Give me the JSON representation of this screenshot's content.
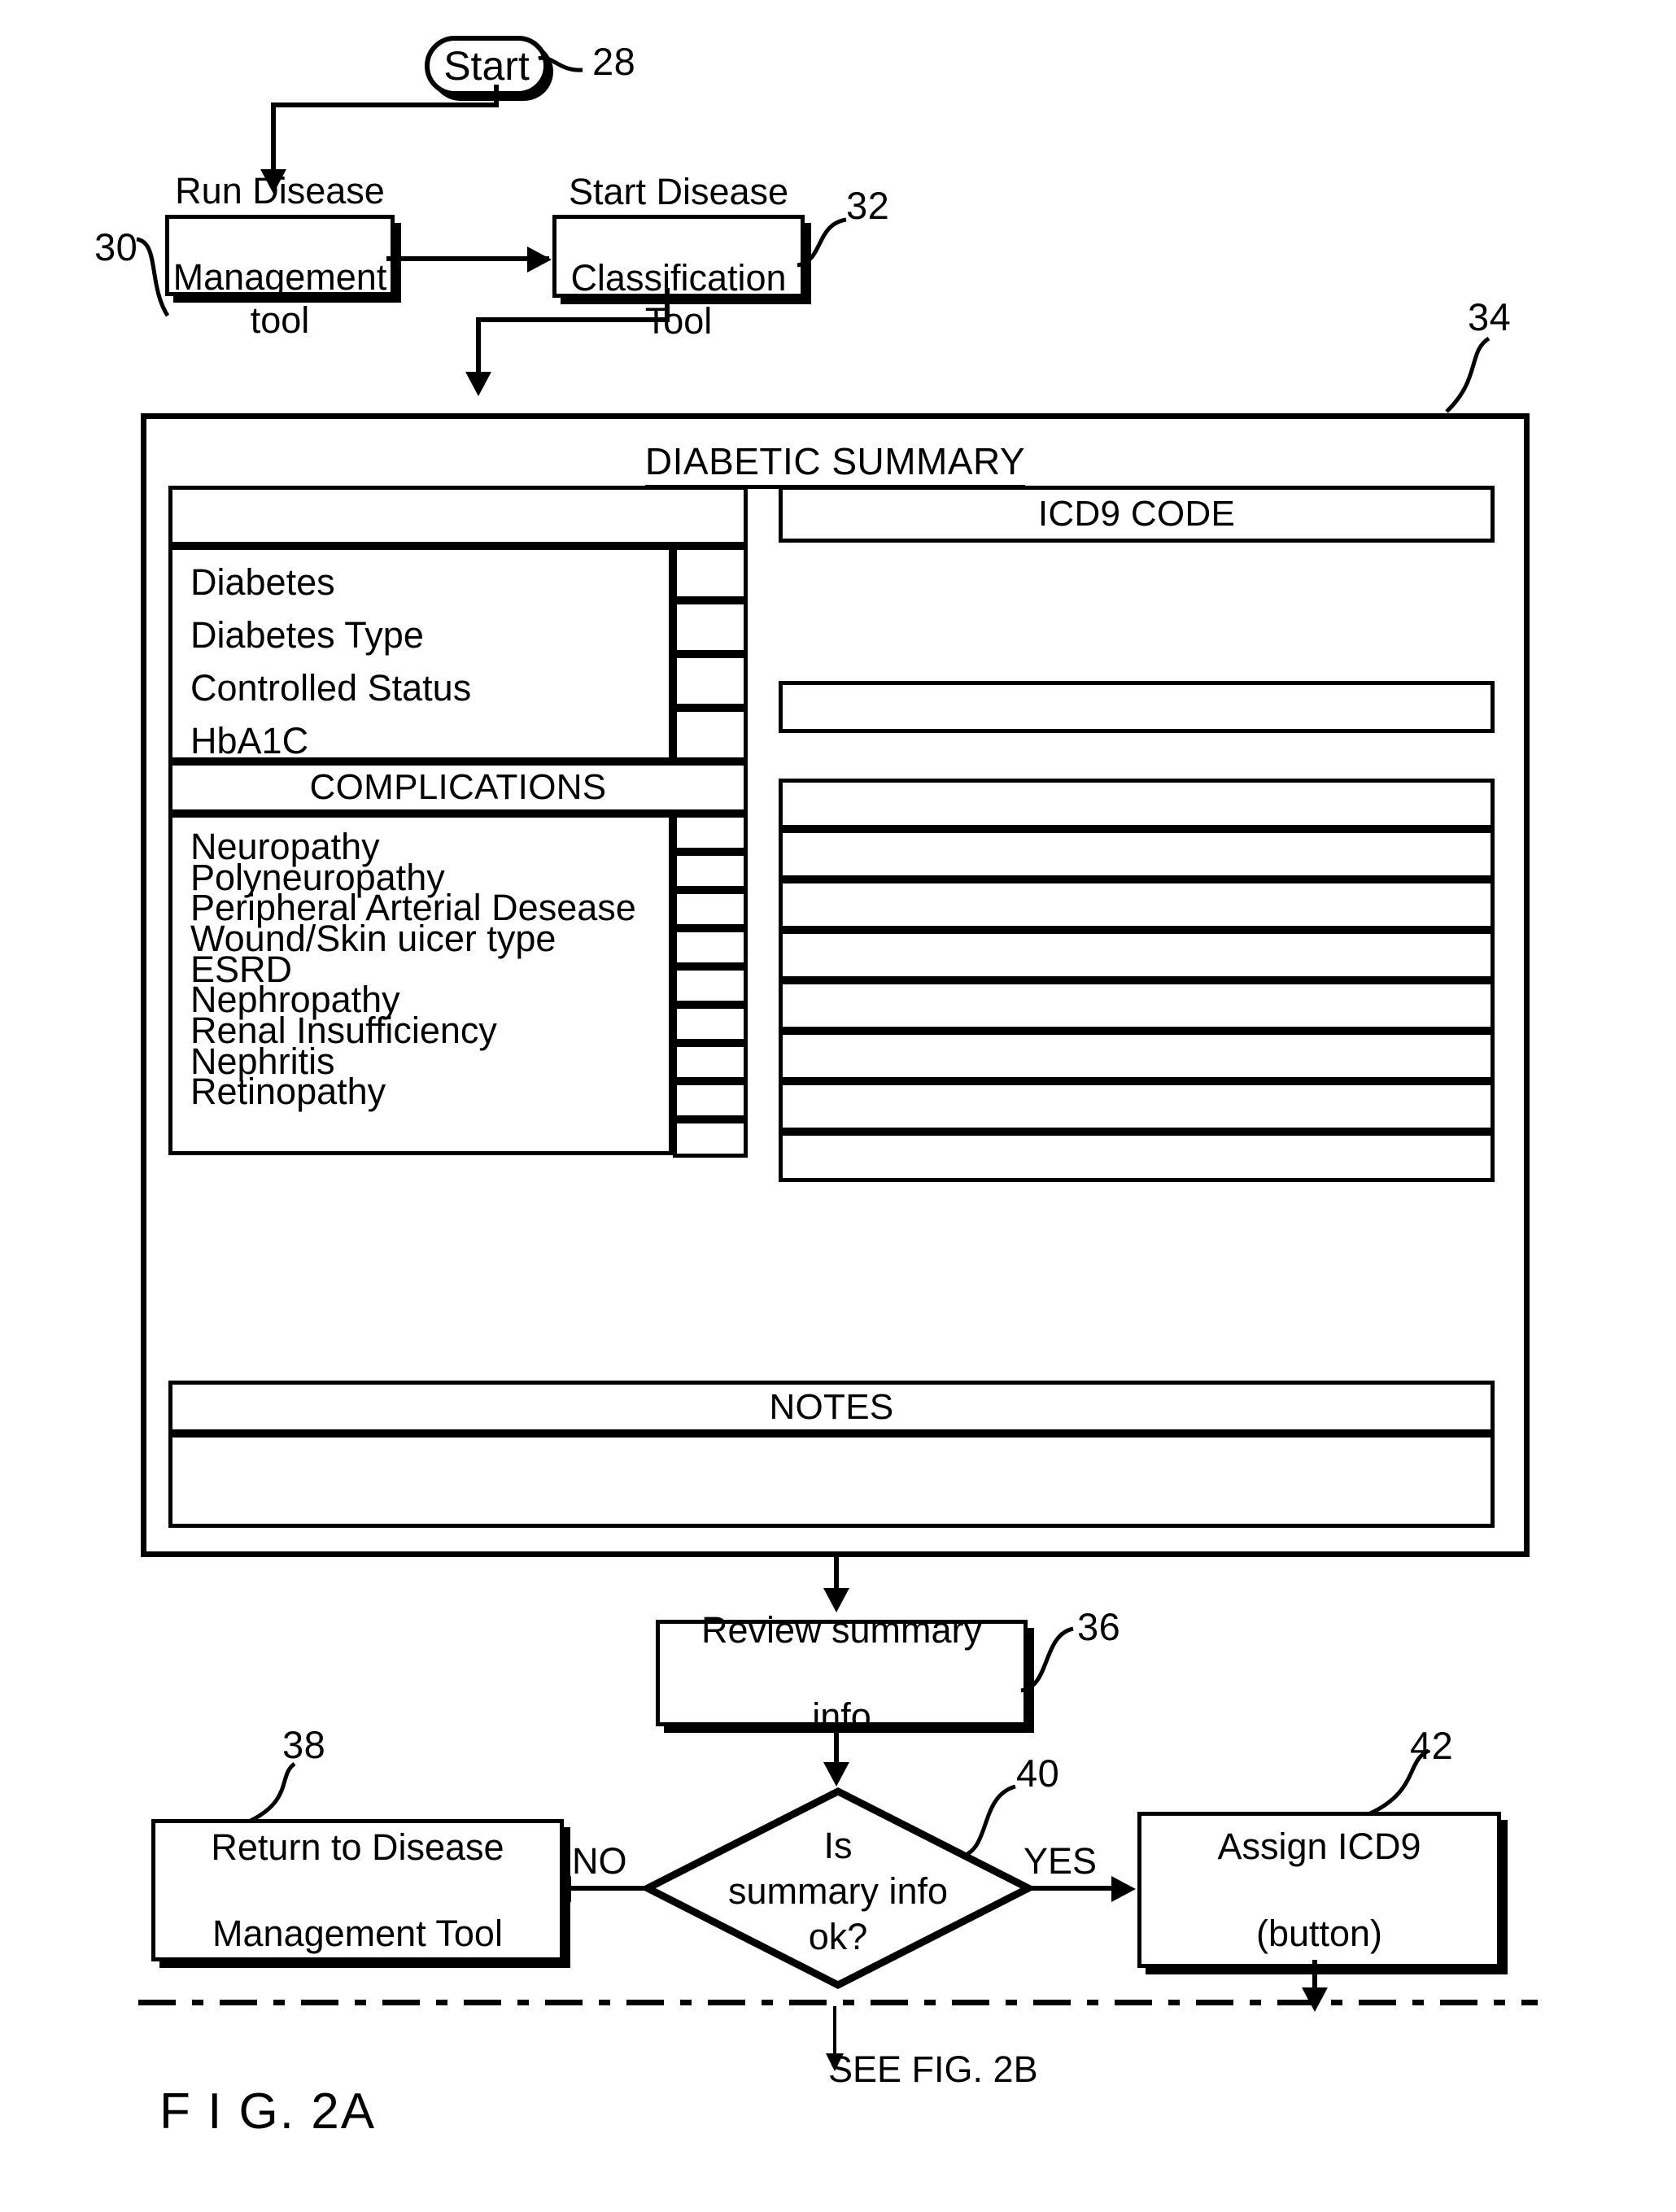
{
  "figure": {
    "label": "F I G. 2A",
    "see_next": "SEE FIG. 2B"
  },
  "flow": {
    "start": {
      "label": "Start",
      "ref": "28"
    },
    "run_dm_tool": {
      "label_line1": "Run Disease",
      "label_line2": "Management tool",
      "ref": "30"
    },
    "start_classification": {
      "label_line1": "Start Disease",
      "label_line2": "Classification Tool",
      "ref": "32"
    },
    "summary_panel_ref": "34",
    "review": {
      "label_line1": "Review summary",
      "label_line2": "info",
      "ref": "36"
    },
    "decision": {
      "label_line1": "Is",
      "label_line2": "summary info",
      "label_line3": "ok?",
      "ref": "40",
      "branch_no": "NO",
      "branch_yes": "YES"
    },
    "return_dm_tool": {
      "label_line1": "Return to Disease",
      "label_line2": "Management Tool",
      "ref": "38"
    },
    "assign_icd9": {
      "label_line1": "Assign ICD9",
      "label_line2": "(button)",
      "ref": "42"
    }
  },
  "summary_form": {
    "title": "DIABETIC SUMMARY",
    "left_panel": {
      "top_blank_header": "",
      "fields": [
        {
          "label": "Diabetes",
          "value": ""
        },
        {
          "label": "Diabetes Type",
          "value": ""
        },
        {
          "label": "Controlled Status",
          "value": ""
        },
        {
          "label": "HbA1C",
          "value": ""
        }
      ],
      "complications_header": "COMPLICATIONS",
      "complications": [
        {
          "label": "Neuropathy",
          "value": ""
        },
        {
          "label": "Polyneuropathy",
          "value": ""
        },
        {
          "label": "Peripheral Arterial Desease",
          "value": ""
        },
        {
          "label": "Wound/Skin uicer type",
          "value": ""
        },
        {
          "label": "ESRD",
          "value": ""
        },
        {
          "label": "Nephropathy",
          "value": ""
        },
        {
          "label": "Renal Insufficiency",
          "value": ""
        },
        {
          "label": "Nephritis",
          "value": ""
        },
        {
          "label": "Retinopathy",
          "value": ""
        }
      ]
    },
    "right_panel": {
      "icd9_header": "ICD9 CODE",
      "icd9_entry_value": "",
      "icd9_rows": [
        "",
        "",
        "",
        "",
        "",
        "",
        "",
        ""
      ]
    },
    "notes": {
      "header": "NOTES",
      "value": ""
    }
  },
  "colors": {
    "ink": "#000000",
    "paper": "#ffffff"
  }
}
